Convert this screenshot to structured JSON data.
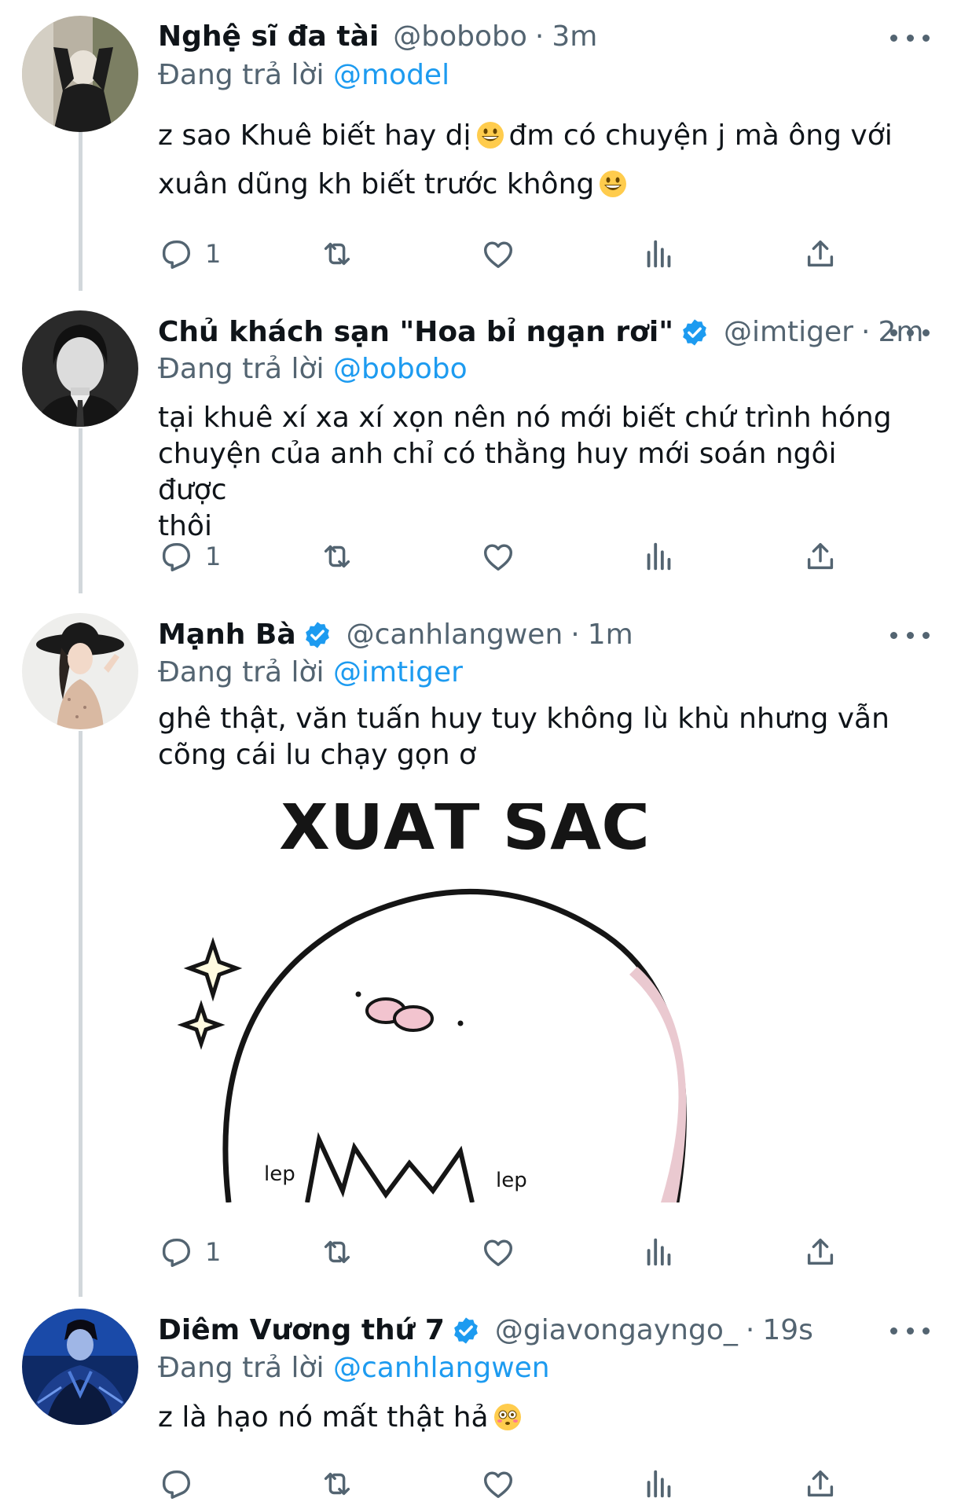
{
  "tweets": [
    {
      "display_name": "Nghệ sĩ đa tài",
      "handle": "@bobobo",
      "dot": "·",
      "time": "3m",
      "reply_prefix": "Đang trả lời",
      "reply_to": "@model",
      "text_line1": "z sao Khuê biết hay dị",
      "text_line1b": "đm có chuyện j mà ông với",
      "text_line2": "xuân dũng kh biết trước không",
      "reply_count": "1"
    },
    {
      "display_name": "Chủ khách sạn \"Hoa bỉ ngạn rơi\"",
      "handle": "@imtiger",
      "dot": "·",
      "time": "2m",
      "reply_prefix": "Đang trả lời",
      "reply_to": "@bobobo",
      "text_line1": "tại khuê xí xa xí xọn nên nó mới biết chứ trình hóng",
      "text_line2": "chuyện của anh chỉ có thằng huy mới soán ngôi được",
      "text_line3": "thôi",
      "reply_count": "1"
    },
    {
      "display_name": "Mạnh Bà",
      "handle": "@canhlangwen",
      "dot": "·",
      "time": "1m",
      "reply_prefix": "Đang trả lời",
      "reply_to": "@imtiger",
      "text_line1": "ghê thật, văn tuấn huy tuy không lù khù nhưng vẫn",
      "text_line2": "cõng cái lu chạy gọn ơ",
      "media_caption": "XUẤT SẮC",
      "media_side_left": "lep",
      "media_side_right": "lep",
      "reply_count": "1"
    },
    {
      "display_name": "Diêm Vương thứ 7",
      "handle": "@giavongayngo_",
      "dot": "·",
      "time": "19s",
      "reply_prefix": "Đang trả lời",
      "reply_to": "@canhlangwen",
      "text_line1": "z là hạo nó mất thật hả"
    }
  ],
  "colors": {
    "text_primary": "#0f1419",
    "text_secondary": "#536471",
    "accent": "#1d9bf0",
    "thread_line": "#d2d7db"
  },
  "icons": [
    "reply-icon",
    "retweet-icon",
    "like-icon",
    "views-icon",
    "share-icon",
    "more-icon",
    "verified-badge-icon"
  ]
}
